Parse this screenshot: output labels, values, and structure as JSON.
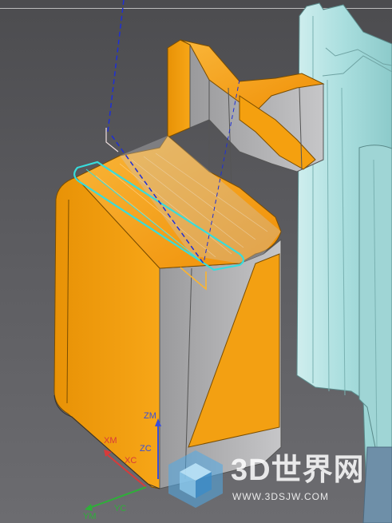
{
  "viewport": {
    "background_colors": [
      "#4c4c4f",
      "#6c6c70"
    ],
    "part_color": "#f5a00f",
    "mold_color": "#b8e4e4",
    "toolpath_color": "#1e2fd6",
    "boundary_color": "#37dcdc"
  },
  "axes": {
    "zm": "ZM",
    "zc": "ZC",
    "xm": "XM",
    "xc": "XC",
    "ym": "YM",
    "yc": "YC",
    "colors": {
      "z": "#3a4fd8",
      "x": "#d83a3a",
      "y": "#2fae3a"
    }
  },
  "watermark": {
    "title": "3D世界网",
    "url": "WWW.3DSJW.COM",
    "logo_icon": "cube-logo-icon"
  }
}
